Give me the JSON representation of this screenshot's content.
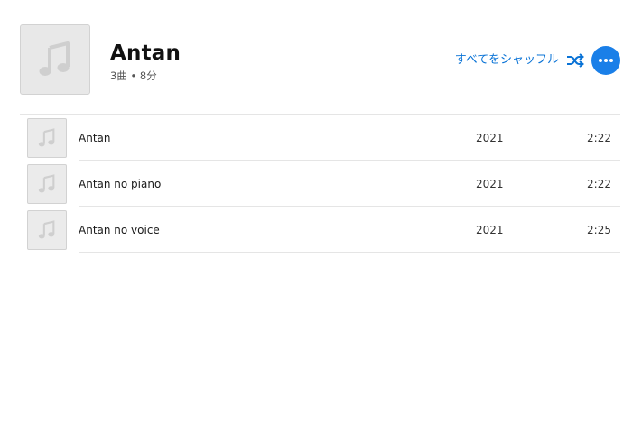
{
  "album": {
    "title": "Antan",
    "meta": "3曲 • 8分",
    "art_icon": "music-note-icon"
  },
  "actions": {
    "shuffle_label": "すべてをシャッフル",
    "shuffle_icon": "shuffle-icon",
    "more_icon": "more-icon"
  },
  "colors": {
    "accent": "#0a73d6",
    "more_button": "#1a7fe8"
  },
  "tracks": [
    {
      "title": "Antan",
      "year": "2021",
      "duration": "2:22"
    },
    {
      "title": "Antan no piano",
      "year": "2021",
      "duration": "2:22"
    },
    {
      "title": "Antan no voice",
      "year": "2021",
      "duration": "2:25"
    }
  ]
}
